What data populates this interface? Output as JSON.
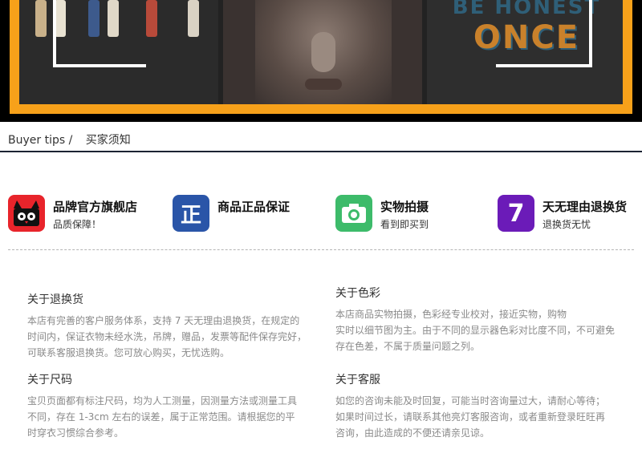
{
  "banner": {
    "poster_line1": "BE HONEST",
    "poster_line2": "ONCE",
    "frame_color": "#f7a11a"
  },
  "breadcrumb": {
    "english": "Buyer tips /",
    "chinese": "买家须知"
  },
  "features": [
    {
      "icon": "tmall-cat-icon",
      "glyph": "",
      "color": "#e8242b",
      "title": "品牌官方旗舰店",
      "subtitle": "品质保障！"
    },
    {
      "icon": "genuine-icon",
      "glyph": "正",
      "color": "#2a55a8",
      "title": "商品正品保证",
      "subtitle": ""
    },
    {
      "icon": "camera-icon",
      "glyph": "",
      "color": "#3dbb6a",
      "title": "实物拍摄",
      "subtitle": "看到即买到"
    },
    {
      "icon": "seven-day-icon",
      "glyph": "7",
      "color": "#6b1bb8",
      "title": "天无理由退换货",
      "subtitle": "退换货无忧"
    }
  ],
  "policies": {
    "returns": {
      "title": "关于退换货",
      "lines": [
        "本店有完善的客户服务体系，支持 7 天无理由退换货，在规定的",
        "时间内，保证衣物未经水洗，吊牌，赠品，发票等配件保存完好，",
        "可联系客服退换货。您可放心购买，无忧选购。"
      ]
    },
    "color": {
      "title": "关于色彩",
      "lines": [
        "本店商品实物拍摄，色彩经专业校对，接近实物，购物",
        "实时以细节图为主。由于不同的显示器色彩对比度不同，不可避免",
        "存在色差，不属于质量问题之列。"
      ]
    },
    "size": {
      "title": "关于尺码",
      "lines": [
        "宝贝页面都有标注尺码，均为人工测量，因测量方法或测量工具",
        "不同，存在 1-3cm 左右的误差，属于正常范围。请根据您的平",
        "时穿衣习惯综合参考。"
      ]
    },
    "service": {
      "title": "关于客服",
      "lines": [
        "如您的咨询未能及时回复，可能当时咨询量过大，请耐心等待；",
        "如果时间过长，请联系其他亮灯客服咨询，或者重新登录旺旺再",
        "咨询，由此造成的不便还请亲见谅。"
      ]
    }
  }
}
